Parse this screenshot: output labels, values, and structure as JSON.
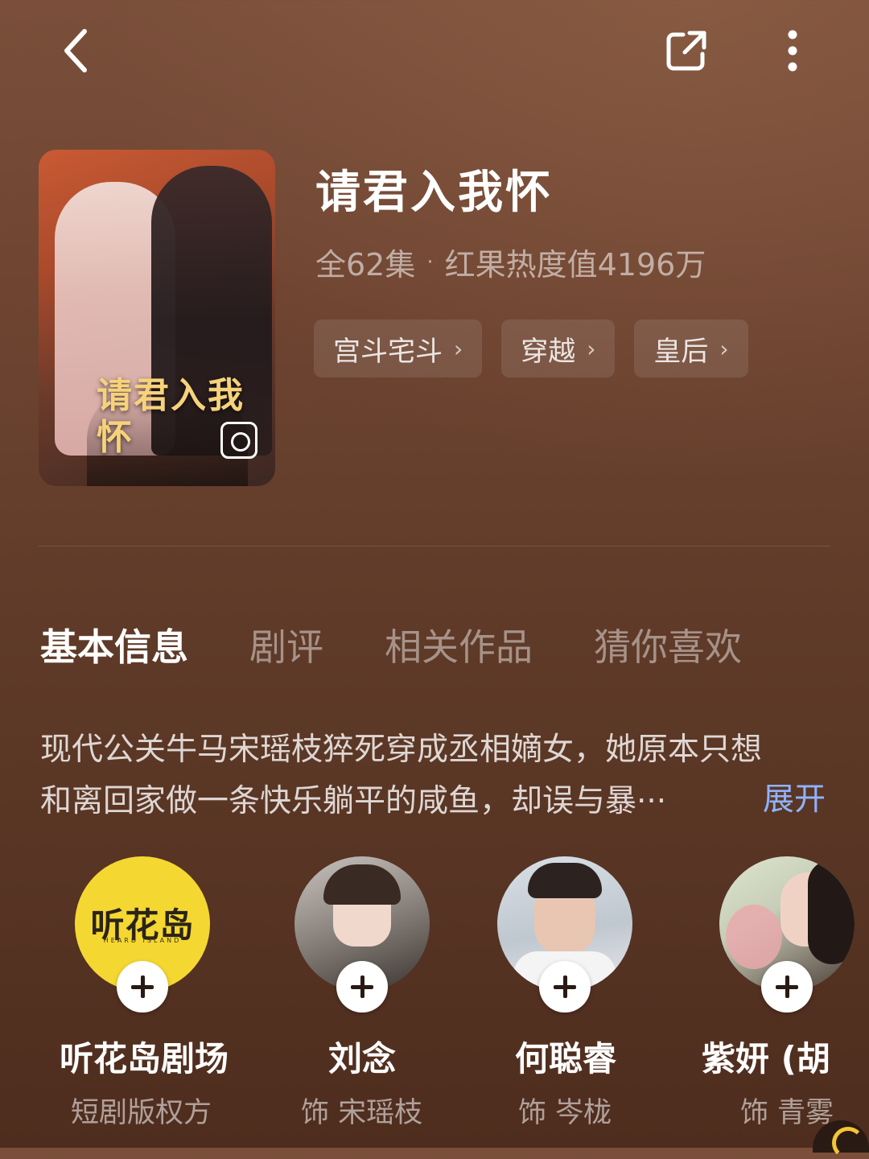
{
  "header": {
    "back_icon": "chevron-left-icon",
    "share_icon": "share-icon",
    "more_icon": "more-vertical-icon"
  },
  "drama": {
    "poster_title": "请君入我怀",
    "title": "请君入我怀",
    "episodes": "全62集",
    "separator": "·",
    "popularity": "红果热度值4196万",
    "tags": [
      "宫斗宅斗",
      "穿越",
      "皇后"
    ]
  },
  "tabs": [
    {
      "label": "基本信息",
      "active": true
    },
    {
      "label": "剧评",
      "active": false
    },
    {
      "label": "相关作品",
      "active": false
    },
    {
      "label": "猜你喜欢",
      "active": false
    }
  ],
  "synopsis": {
    "line1": "现代公关牛马宋瑶枝猝死穿成丞相嫡女，她原本只想",
    "line2": "和离回家做一条快乐躺平的咸鱼，却误与暴···",
    "expand_label": "展开"
  },
  "cast": [
    {
      "name": "听花岛剧场",
      "role": "短剧版权方",
      "logo_text": "听花岛",
      "logo_sub": "HEARD ISLAND"
    },
    {
      "name": "刘念",
      "role": "饰 宋瑶枝"
    },
    {
      "name": "何聪睿",
      "role": "饰 岑栊"
    },
    {
      "name": "紫妍 (胡·",
      "role": "饰 青雾"
    }
  ],
  "colors": {
    "background": "#6a4230",
    "accent_link": "#8fb3ff",
    "logo_yellow": "#f5d732"
  }
}
